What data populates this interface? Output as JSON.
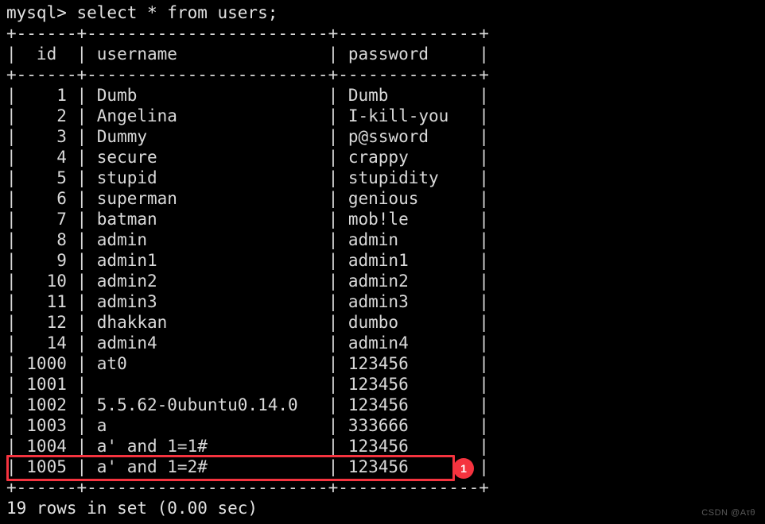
{
  "terminal": {
    "background_color": "#000000",
    "text_color": "#d9d9d9",
    "prompt_line": "mysql> select * from users;",
    "separator_line": "+------+------------------------+--------------+",
    "header_line": "|  id  | username               | password     |",
    "status_line": "19 rows in set (0.00 sec)"
  },
  "table": {
    "columns": [
      "id",
      "username",
      "password"
    ],
    "rows": [
      {
        "id": "1",
        "username": "Dumb",
        "password": "Dumb"
      },
      {
        "id": "2",
        "username": "Angelina",
        "password": "I-kill-you"
      },
      {
        "id": "3",
        "username": "Dummy",
        "password": "p@ssword"
      },
      {
        "id": "4",
        "username": "secure",
        "password": "crappy"
      },
      {
        "id": "5",
        "username": "stupid",
        "password": "stupidity"
      },
      {
        "id": "6",
        "username": "superman",
        "password": "genious"
      },
      {
        "id": "7",
        "username": "batman",
        "password": "mob!le"
      },
      {
        "id": "8",
        "username": "admin",
        "password": "admin"
      },
      {
        "id": "9",
        "username": "admin1",
        "password": "admin1"
      },
      {
        "id": "10",
        "username": "admin2",
        "password": "admin2"
      },
      {
        "id": "11",
        "username": "admin3",
        "password": "admin3"
      },
      {
        "id": "12",
        "username": "dhakkan",
        "password": "dumbo"
      },
      {
        "id": "14",
        "username": "admin4",
        "password": "admin4"
      },
      {
        "id": "1000",
        "username": "at0",
        "password": "123456"
      },
      {
        "id": "1001",
        "username": "",
        "password": "123456"
      },
      {
        "id": "1002",
        "username": "5.5.62-0ubuntu0.14.0",
        "password": "123456"
      },
      {
        "id": "1003",
        "username": "a",
        "password": "333666"
      },
      {
        "id": "1004",
        "username": "a' and 1=1#",
        "password": "123456"
      },
      {
        "id": "1005",
        "username": "a' and 1=2#",
        "password": "123456"
      }
    ]
  },
  "annotation": {
    "badge_label": "1",
    "badge_color": "#f5333f",
    "highlighted_row_id": "1005"
  },
  "watermark": {
    "text": "CSDN @Aτθ"
  }
}
